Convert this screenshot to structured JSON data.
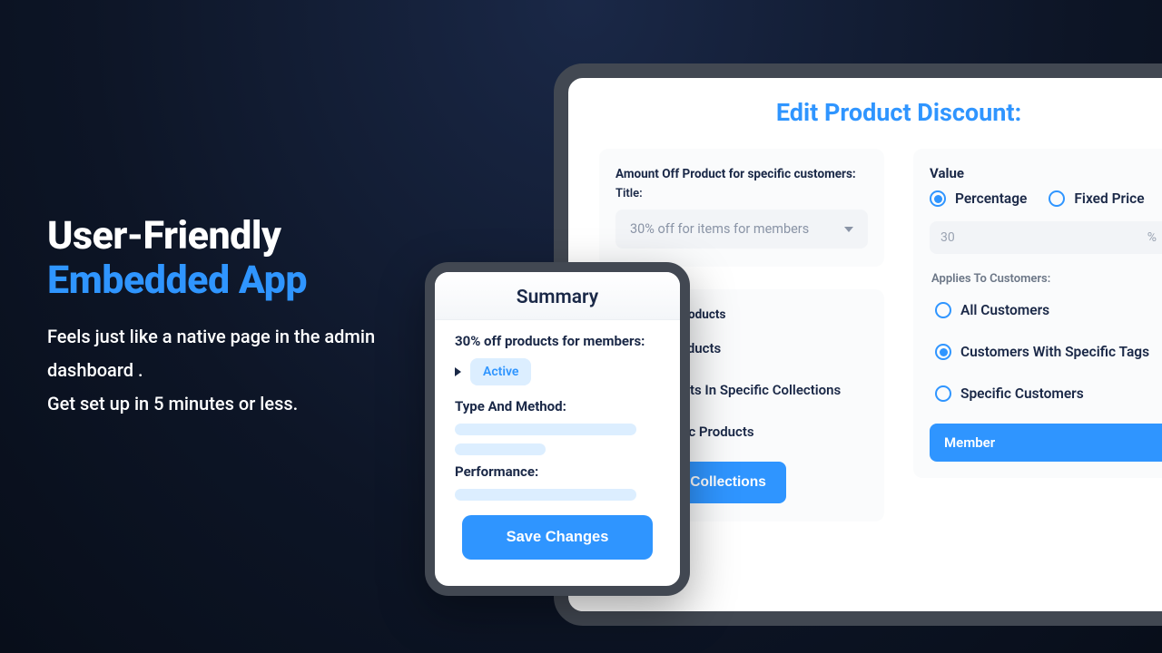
{
  "hero": {
    "title_line1": "User-Friendly",
    "title_line2": "Embedded App",
    "body_line1": "Feels just like a native page in the admin dashboard .",
    "body_line2": "Get set up in 5 minutes or less."
  },
  "panel": {
    "title": "Edit Product Discount:",
    "amount_off": {
      "heading": "Amount Off Product for specific customers:",
      "title_label": "Title:",
      "selected": "30% off for items for members"
    },
    "applies_products": {
      "heading": "Applies To Products",
      "options": {
        "all": "All Products",
        "collections": "Products In Specific Collections",
        "specific": "Specific Products"
      },
      "browse_btn": "Browse Collections"
    },
    "value": {
      "heading": "Value",
      "percentage_label": "Percentage",
      "fixed_label": "Fixed Price",
      "amount": "30",
      "unit": "%"
    },
    "applies_customers": {
      "heading": "Applies To Customers:",
      "options": {
        "all": "All Customers",
        "tags": "Customers With Specific Tags",
        "specific": "Specific Customers"
      },
      "tag_chip": "Member"
    }
  },
  "summary": {
    "title": "Summary",
    "headline": "30% off products for members:",
    "status": "Active",
    "type_heading": "Type And Method:",
    "performance_heading": "Performance:",
    "save_btn": "Save Changes"
  }
}
